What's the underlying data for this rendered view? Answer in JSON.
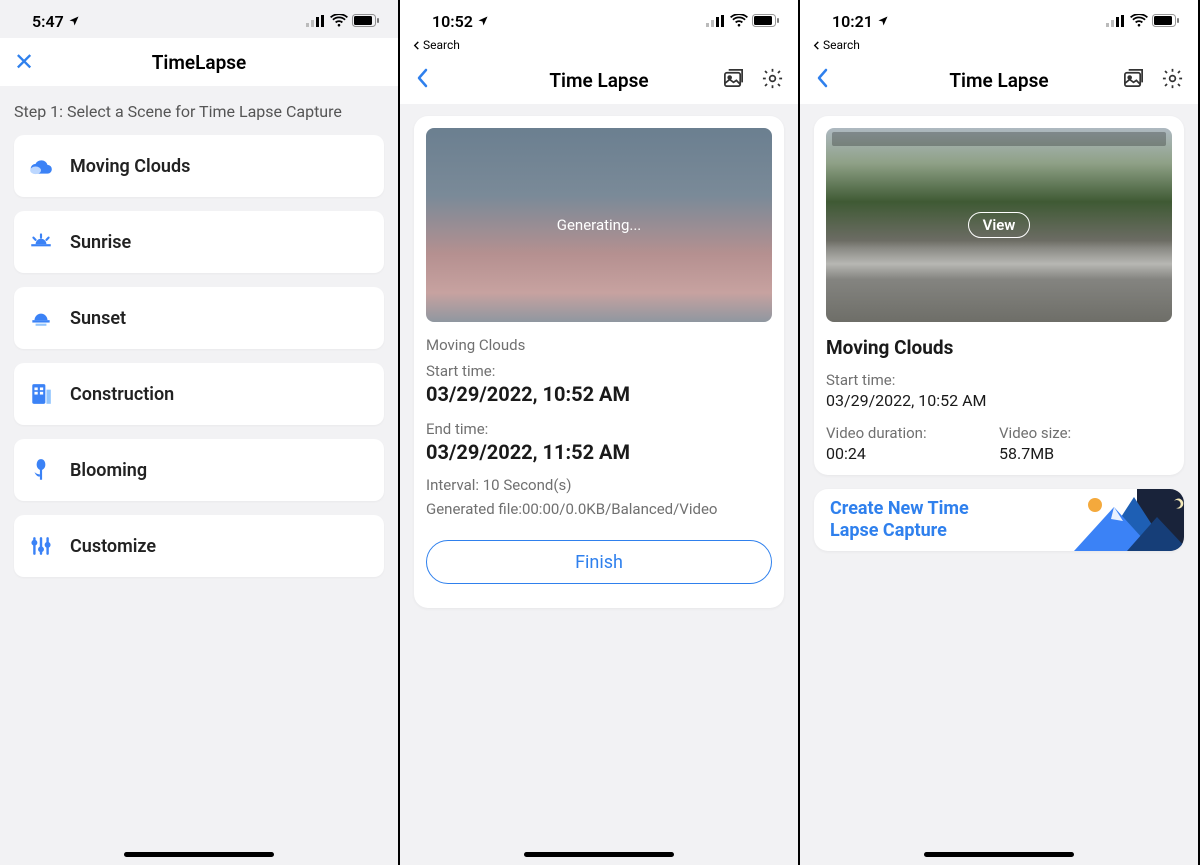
{
  "screen1": {
    "status_time": "5:47",
    "nav_title": "TimeLapse",
    "step_text": "Step 1: Select a Scene for Time Lapse Capture",
    "scenes": {
      "s0": "Moving Clouds",
      "s1": "Sunrise",
      "s2": "Sunset",
      "s3": "Construction",
      "s4": "Blooming",
      "s5": "Customize"
    }
  },
  "screen2": {
    "status_time": "10:52",
    "back_search": "Search",
    "nav_title": "Time Lapse",
    "preview_status": "Generating...",
    "scene_name": "Moving Clouds",
    "start_label": "Start time:",
    "start_value": "03/29/2022, 10:52 AM",
    "end_label": "End time:",
    "end_value": "03/29/2022, 11:52 AM",
    "interval_text": "Interval: 10 Second(s)",
    "generated_text": "Generated file:00:00/0.0KB/Balanced/Video",
    "finish_label": "Finish"
  },
  "screen3": {
    "status_time": "10:21",
    "back_search": "Search",
    "nav_title": "Time Lapse",
    "view_label": "View",
    "scene_name": "Moving Clouds",
    "start_label": "Start time:",
    "start_value": "03/29/2022, 10:52 AM",
    "duration_label": "Video duration:",
    "duration_value": "00:24",
    "size_label": "Video size:",
    "size_value": "58.7MB",
    "create_label": "Create New Time Lapse Capture"
  }
}
